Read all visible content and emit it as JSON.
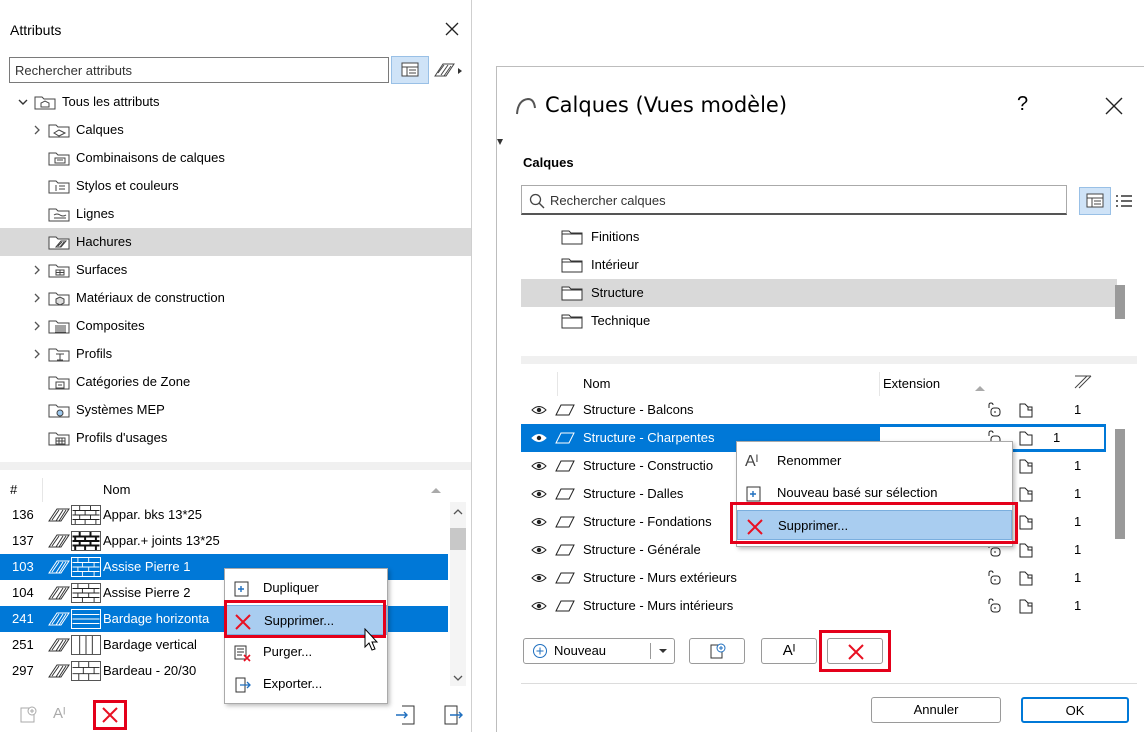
{
  "attributes_panel": {
    "title": "Attributs",
    "search_placeholder": "Rechercher attributs",
    "tree": [
      {
        "label": "Tous les attributs",
        "expander": "expanded",
        "icon": "all-attributes-icon"
      },
      {
        "label": "Calques",
        "expander": "collapsed",
        "icon": "layers-icon"
      },
      {
        "label": "Combinaisons de calques",
        "expander": "none",
        "icon": "layer-combinations-icon"
      },
      {
        "label": "Stylos et couleurs",
        "expander": "none",
        "icon": "pens-colors-icon"
      },
      {
        "label": "Lignes",
        "expander": "none",
        "icon": "lines-icon"
      },
      {
        "label": "Hachures",
        "expander": "none",
        "icon": "fills-icon",
        "selected": true
      },
      {
        "label": "Surfaces",
        "expander": "collapsed",
        "icon": "surfaces-icon"
      },
      {
        "label": "Matériaux de construction",
        "expander": "collapsed",
        "icon": "building-materials-icon"
      },
      {
        "label": "Composites",
        "expander": "collapsed",
        "icon": "composites-icon"
      },
      {
        "label": "Profils",
        "expander": "collapsed",
        "icon": "profiles-icon"
      },
      {
        "label": "Catégories de Zone",
        "expander": "none",
        "icon": "zone-categories-icon"
      },
      {
        "label": "Systèmes MEP",
        "expander": "none",
        "icon": "mep-systems-icon"
      },
      {
        "label": "Profils d'usages",
        "expander": "none",
        "icon": "usage-profiles-icon"
      }
    ],
    "list_headers": {
      "num": "#",
      "name": "Nom"
    },
    "rows": [
      {
        "num": "136",
        "name": "Appar. bks 13*25",
        "selected": false
      },
      {
        "num": "137",
        "name": "Appar.+ joints 13*25",
        "selected": false
      },
      {
        "num": "103",
        "name": "Assise Pierre 1",
        "selected": true
      },
      {
        "num": "104",
        "name": "Assise Pierre 2",
        "selected": false
      },
      {
        "num": "241",
        "name": "Bardage horizonta",
        "selected": true
      },
      {
        "num": "251",
        "name": "Bardage vertical",
        "selected": false
      },
      {
        "num": "297",
        "name": "Bardeau - 20/30",
        "selected": false
      }
    ],
    "context_menu": [
      {
        "label": "Dupliquer",
        "icon": "duplicate-icon",
        "highlighted": false
      },
      {
        "label": "Supprimer...",
        "icon": "delete-icon",
        "highlighted": true
      },
      {
        "label": "Purger...",
        "icon": "purge-icon",
        "highlighted": false
      },
      {
        "label": "Exporter...",
        "icon": "export-icon",
        "highlighted": false
      }
    ]
  },
  "layers_dialog": {
    "title": "Calques (Vues modèle)",
    "help": "?",
    "section_label": "Calques",
    "search_placeholder": "Rechercher calques",
    "folders": [
      {
        "label": "Finitions",
        "selected": false
      },
      {
        "label": "Intérieur",
        "selected": false
      },
      {
        "label": "Structure",
        "selected": true
      },
      {
        "label": "Technique",
        "selected": false
      }
    ],
    "headers": {
      "name": "Nom",
      "extension": "Extension"
    },
    "rows": [
      {
        "name": "Structure - Balcons",
        "pen": "1",
        "selected": false
      },
      {
        "name": "Structure - Charpentes",
        "pen": "1",
        "selected": true
      },
      {
        "name": "Structure - Constructio",
        "pen": "1",
        "selected": false
      },
      {
        "name": "Structure - Dalles",
        "pen": "1",
        "selected": false
      },
      {
        "name": "Structure - Fondations",
        "pen": "1",
        "selected": false
      },
      {
        "name": "Structure - Générale",
        "pen": "1",
        "selected": false
      },
      {
        "name": "Structure - Murs extérieurs",
        "pen": "1",
        "selected": false
      },
      {
        "name": "Structure - Murs intérieurs",
        "pen": "1",
        "selected": false
      }
    ],
    "context_menu": [
      {
        "label": "Renommer",
        "icon": "rename-icon",
        "highlighted": false
      },
      {
        "label": "Nouveau basé sur sélection",
        "icon": "new-from-selection-icon",
        "highlighted": false
      },
      {
        "label": "Supprimer...",
        "icon": "delete-icon",
        "highlighted": true
      }
    ],
    "toolbar": {
      "new_label": "Nouveau"
    },
    "footer": {
      "cancel": "Annuler",
      "ok": "OK"
    }
  },
  "colors": {
    "selection": "#0078d7",
    "menu_highlight": "#a9cdf0",
    "callout_red": "#e4001a",
    "delete_red": "#e81123"
  }
}
